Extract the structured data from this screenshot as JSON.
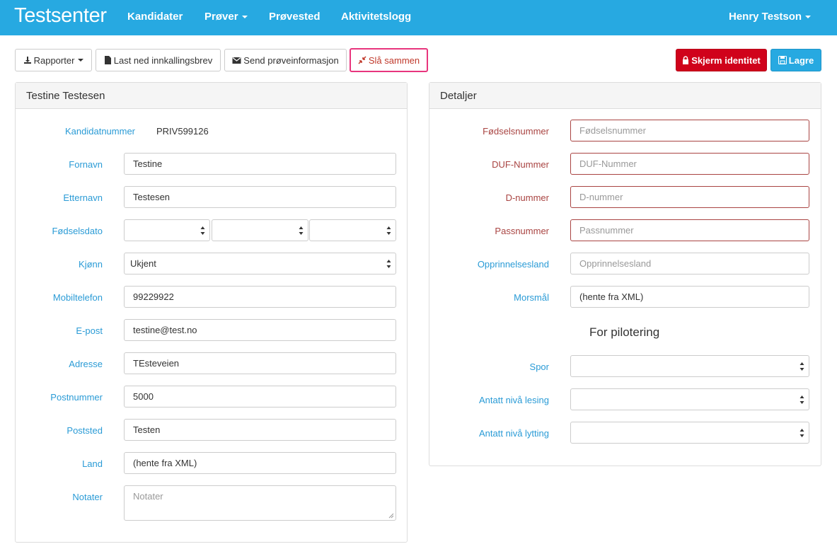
{
  "navbar": {
    "brand": "Testsenter",
    "items": [
      "Kandidater",
      "Prøver",
      "Prøvested",
      "Aktivitetslogg"
    ],
    "user": "Henry Testson"
  },
  "toolbar": {
    "reports_label": "Rapporter",
    "download_label": "Last ned innkallingsbrev",
    "send_label": "Send prøveinformasjon",
    "merge_label": "Slå sammen",
    "shield_label": "Skjerm identitet",
    "save_label": "Lagre"
  },
  "candidate": {
    "title": "Testine Testesen",
    "candidate_number_label": "Kandidatnummer",
    "candidate_number": "PRIV599126",
    "first_name_label": "Fornavn",
    "first_name": "Testine",
    "last_name_label": "Etternavn",
    "last_name": "Testesen",
    "birthdate_label": "Fødselsdato",
    "gender_label": "Kjønn",
    "gender": "Ukjent",
    "mobile_label": "Mobiltelefon",
    "mobile": "99229922",
    "email_label": "E-post",
    "email": "testine@test.no",
    "address_label": "Adresse",
    "address": "TEsteveien",
    "postal_code_label": "Postnummer",
    "postal_code": "5000",
    "city_label": "Poststed",
    "city": "Testen",
    "country_label": "Land",
    "country": "(hente fra XML)",
    "notes_label": "Notater",
    "notes_placeholder": "Notater"
  },
  "details": {
    "title": "Detaljer",
    "ssn_label": "Fødselsnummer",
    "ssn_placeholder": "Fødselsnummer",
    "duf_label": "DUF-Nummer",
    "duf_placeholder": "DUF-Nummer",
    "dnum_label": "D-nummer",
    "dnum_placeholder": "D-nummer",
    "passport_label": "Passnummer",
    "passport_placeholder": "Passnummer",
    "origin_label": "Opprinnelsesland",
    "origin_placeholder": "Opprinnelsesland",
    "mother_tongue_label": "Morsmål",
    "mother_tongue": "(hente fra XML)",
    "pilot_title": "For pilotering",
    "track_label": "Spor",
    "reading_label": "Antatt nivå lesing",
    "listening_label": "Antatt nivå lytting"
  },
  "colors": {
    "primary": "#27a9e1",
    "danger": "#d0021b",
    "error": "#a94442",
    "label": "#2a9bd6",
    "merge_outline": "#e8357d"
  }
}
